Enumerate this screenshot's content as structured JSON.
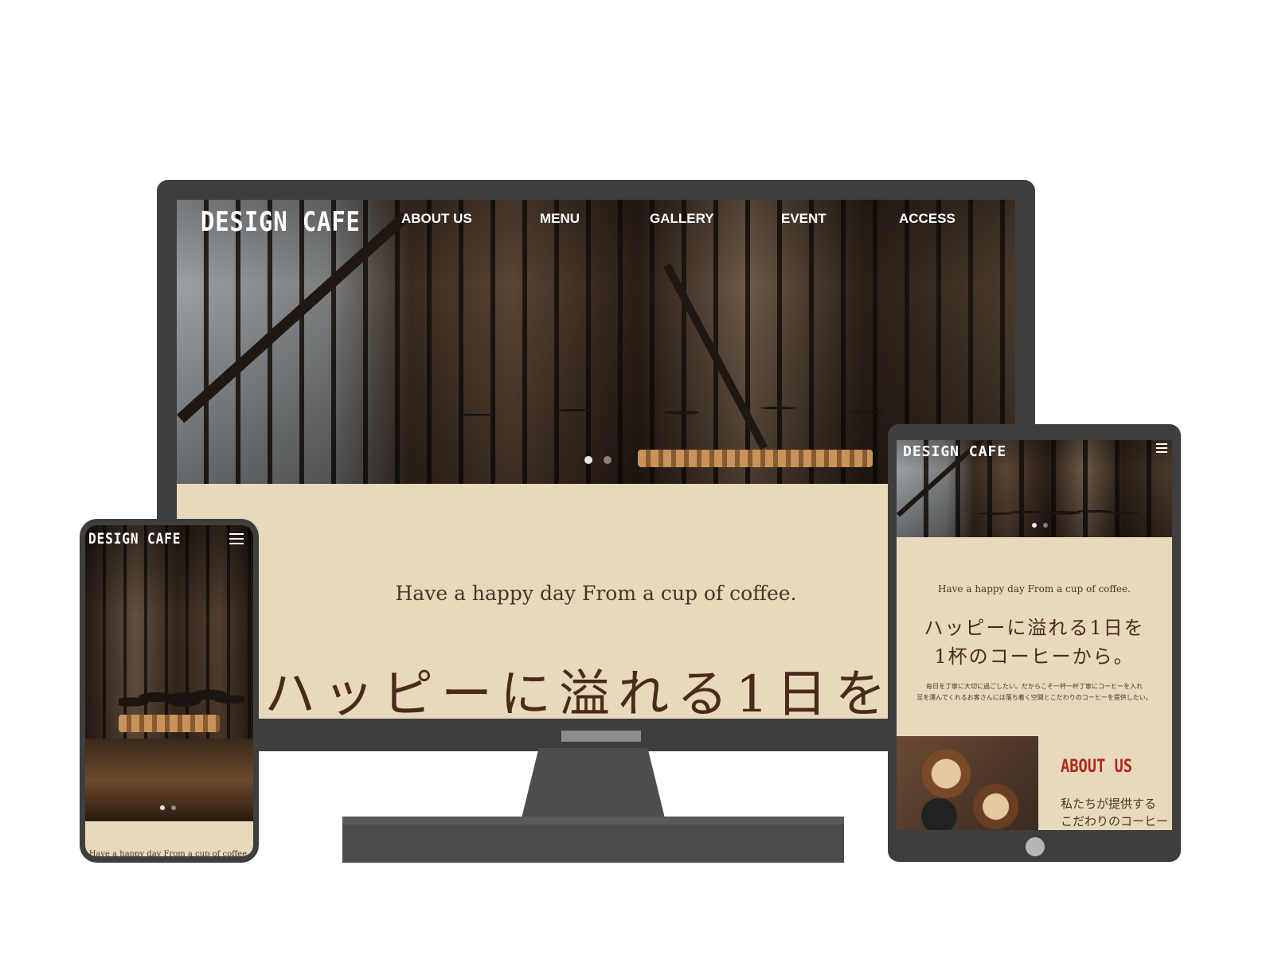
{
  "desktop": {
    "logo": "DESIGN CAFE",
    "nav": [
      "ABOUT US",
      "MENU",
      "GALLERY",
      "EVENT",
      "ACCESS"
    ],
    "slider": {
      "count": 2,
      "active": 1
    },
    "tagline": "Have a happy day From a cup of coffee.",
    "headline": "ハッピーに溢れる1日を"
  },
  "tablet": {
    "logo": "DESIGN CAFE",
    "menu_icon": "hamburger-icon",
    "tagline": "Have a happy day From a cup of coffee.",
    "headline": [
      "ハッピーに溢れる1日を",
      "1杯のコーヒーから。"
    ],
    "body": [
      "毎日を丁寧に大切に過ごしたい。だからこそ一杯一杯丁寧にコーヒーを入れ",
      "足を運んでくれるお客さんには落ち着く空間とこだわりのコーヒーを提供したい。"
    ],
    "about": {
      "title": "ABOUT US",
      "lines": [
        "私たちが提供する",
        "こだわりのコーヒー"
      ]
    }
  },
  "phone": {
    "logo": "DESIGN CAFE",
    "menu_icon": "hamburger-icon",
    "tagline": "Have a happy day From a cup of coffee."
  },
  "colors": {
    "background": "#e8d9bc",
    "device": "#3e3e3e",
    "text_brown": "#4a2a1a",
    "about_red": "#b02a1e"
  }
}
